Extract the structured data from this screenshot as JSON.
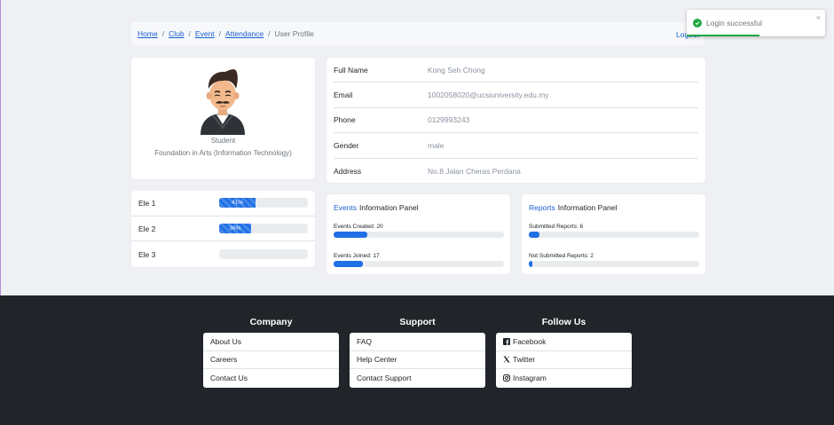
{
  "breadcrumb": {
    "links": [
      "Home",
      "Club",
      "Event",
      "Attendance"
    ],
    "current": "User Profile",
    "separator": "/",
    "logout_label": "Logout"
  },
  "profile": {
    "role": "Student",
    "course": "Foundation in Arts (Information Technology)"
  },
  "details": [
    {
      "label": "Full Name",
      "value": "Kong Seh Chong"
    },
    {
      "label": "Email",
      "value": "1002058020@ucsiuniversity.edu.my"
    },
    {
      "label": "Phone",
      "value": "0129993243"
    },
    {
      "label": "Gender",
      "value": "male"
    },
    {
      "label": "Address",
      "value": "No.8 Jalan Cheras Perdana"
    }
  ],
  "electives": [
    {
      "label": "Ele 1",
      "percent": 41,
      "text": "41%"
    },
    {
      "label": "Ele 2",
      "percent": 36,
      "text": "36%"
    },
    {
      "label": "Ele 3",
      "percent": 0,
      "text": ""
    }
  ],
  "events_panel": {
    "accent": "Events",
    "title": "Information Panel",
    "stats": [
      {
        "label": "Events Created: 20",
        "percent": 20
      },
      {
        "label": "Events Joined: 17",
        "percent": 17
      }
    ]
  },
  "reports_panel": {
    "accent": "Reports",
    "title": "Information Panel",
    "stats": [
      {
        "label": "Submitted Reports: 6",
        "percent": 6
      },
      {
        "label": "Not Submitted Reports: 2",
        "percent": 2
      }
    ]
  },
  "footer": {
    "company": {
      "title": "Company",
      "items": [
        "About Us",
        "Careers",
        "Contact Us"
      ]
    },
    "support": {
      "title": "Support",
      "items": [
        "FAQ",
        "Help Center",
        "Contact Support"
      ]
    },
    "follow": {
      "title": "Follow Us",
      "items": [
        {
          "label": "Facebook",
          "icon": "facebook-icon"
        },
        {
          "label": "Twitter",
          "icon": "x-twitter-icon"
        },
        {
          "label": "Instagram",
          "icon": "instagram-icon"
        }
      ]
    }
  },
  "toast": {
    "message": "Login successful",
    "close_label": "×",
    "icon": "check-circle-icon"
  },
  "colors": {
    "accent": "#1f6fe5",
    "link": "#1a5fd1",
    "success": "#22a845",
    "footer_bg": "#212529"
  }
}
